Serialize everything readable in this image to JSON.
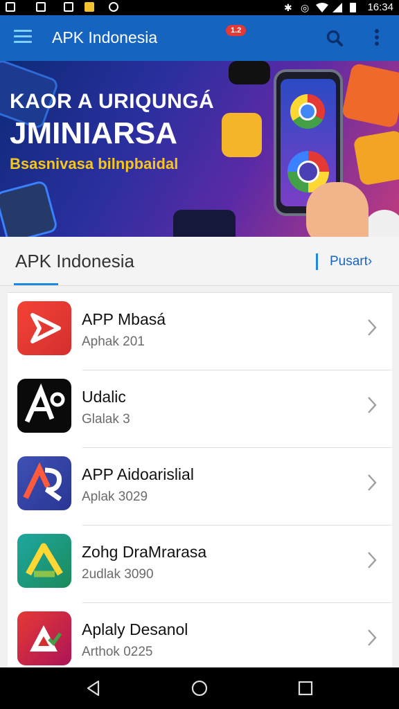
{
  "status_bar": {
    "time": "16:34",
    "right_icons": [
      "nfc-icon",
      "alarm-icon",
      "wifi-icon",
      "signal-icon",
      "battery-icon"
    ],
    "left_icons": [
      "gallery-icon",
      "image-icon",
      "save-icon",
      "app-icon",
      "camera-icon"
    ]
  },
  "app_bar": {
    "title": "APK Indonesia",
    "badge": "1.2",
    "color": "#1565c0"
  },
  "banner": {
    "line1": "KAOR A URIQUNGÁ",
    "line2": "JMINIARSA",
    "line3": "Bsasnivasa bilnpbaidal"
  },
  "section": {
    "title": "APK Indonesia",
    "link": "Pusart›",
    "accent": "#1e88e5"
  },
  "apps": [
    {
      "name": "APP Mbasá",
      "meta": "Aphak 201",
      "icon": "play-icon"
    },
    {
      "name": "Udalic",
      "meta": "Glalak 3",
      "icon": "a-letter-icon"
    },
    {
      "name": "APP Aidoarislial",
      "meta": "Aplak 3029",
      "icon": "ar-logo-icon"
    },
    {
      "name": "Zohg DraMrarasa",
      "meta": "2udlak 3090",
      "icon": "drive-icon"
    },
    {
      "name": "Aplaly Desanol",
      "meta": "Arthok 0225",
      "icon": "a-check-icon"
    }
  ]
}
